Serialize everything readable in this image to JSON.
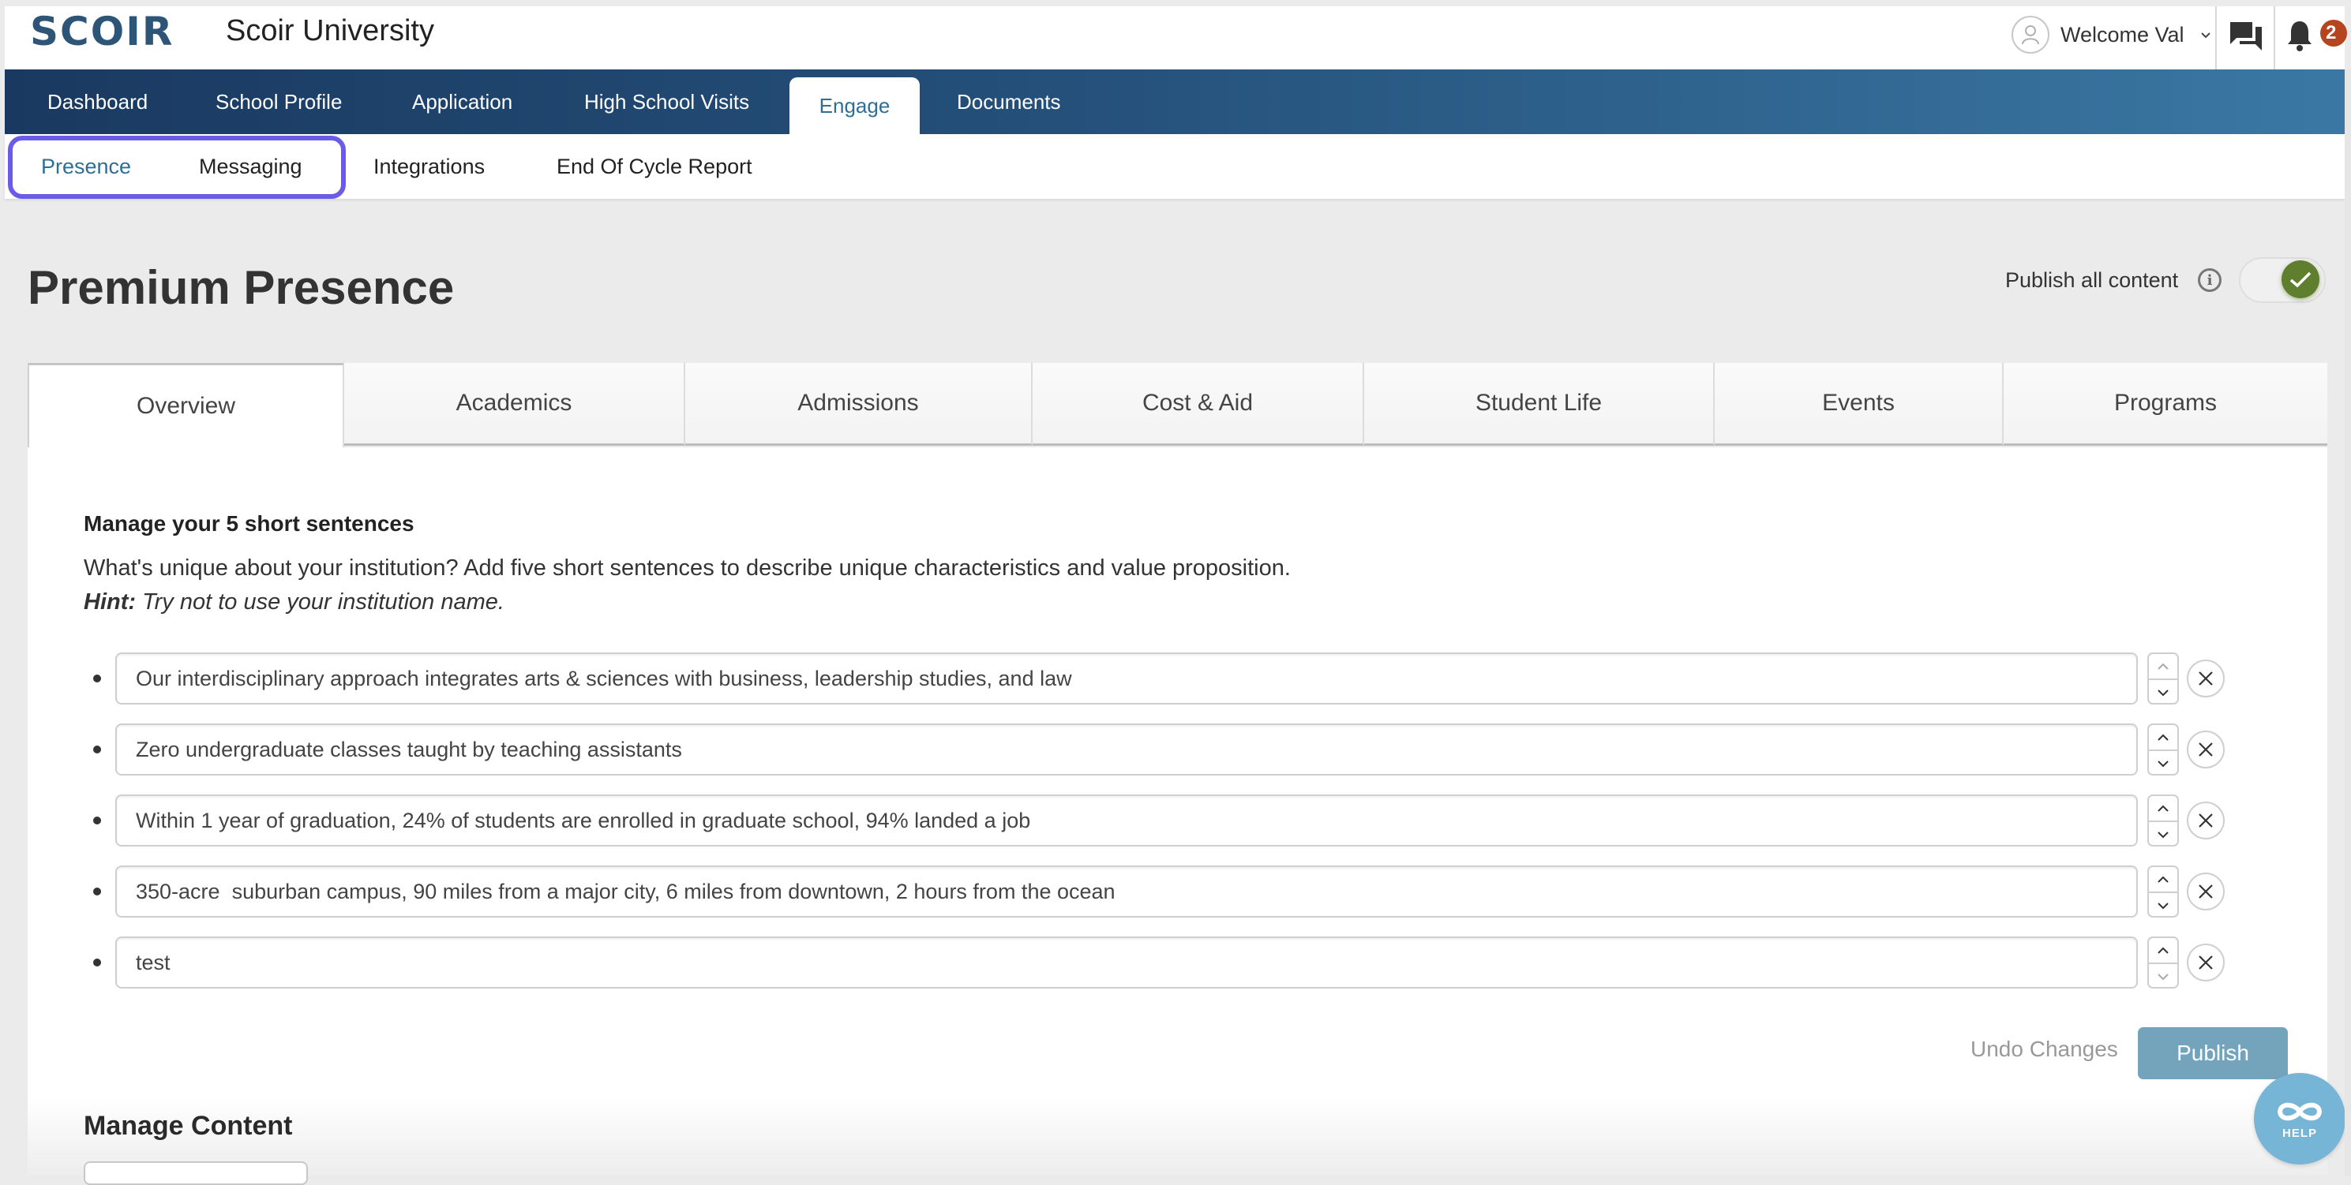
{
  "header": {
    "logo": "SCOIR",
    "school_name": "Scoir University",
    "welcome": "Welcome Val",
    "notification_count": "2"
  },
  "main_nav": {
    "items": [
      {
        "label": "Dashboard",
        "active": false
      },
      {
        "label": "School Profile",
        "active": false
      },
      {
        "label": "Application",
        "active": false
      },
      {
        "label": "High School Visits",
        "active": false
      },
      {
        "label": "Engage",
        "active": true
      },
      {
        "label": "Documents",
        "active": false
      }
    ]
  },
  "sub_nav": {
    "items": [
      {
        "label": "Presence",
        "active": true
      },
      {
        "label": "Messaging",
        "active": false
      },
      {
        "label": "Integrations",
        "active": false
      },
      {
        "label": "End Of Cycle Report",
        "active": false
      }
    ]
  },
  "page": {
    "title": "Premium Presence",
    "publish_all_label": "Publish all content",
    "publish_all_enabled": true
  },
  "tabs": [
    {
      "label": "Overview",
      "active": true
    },
    {
      "label": "Academics",
      "active": false
    },
    {
      "label": "Admissions",
      "active": false
    },
    {
      "label": "Cost & Aid",
      "active": false
    },
    {
      "label": "Student Life",
      "active": false
    },
    {
      "label": "Events",
      "active": false
    },
    {
      "label": "Programs",
      "active": false
    }
  ],
  "sentences_section": {
    "heading": "Manage your 5 short sentences",
    "description": "What's unique about your institution? Add five short sentences to describe unique characteristics and value proposition.",
    "hint_label": "Hint:",
    "hint_text": " Try not to use your institution name.",
    "sentences": [
      "Our interdisciplinary approach integrates arts & sciences with business, leadership studies, and law",
      "Zero undergraduate classes taught by teaching assistants",
      "Within 1 year of graduation, 24% of students are enrolled in graduate school, 94% landed a job",
      "350-acre  suburban campus, 90 miles from a major city, 6 miles from downtown, 2 hours from the ocean",
      "test"
    ],
    "undo_label": "Undo Changes",
    "publish_label": "Publish"
  },
  "manage_content": {
    "heading": "Manage Content"
  },
  "help": {
    "label": "HELP"
  },
  "colors": {
    "nav_start": "#1a3960",
    "nav_end": "#3a78a3",
    "accent": "#2e6f93",
    "highlight": "#6b5ce8",
    "toggle_on": "#5f7e2e",
    "publish_btn": "#74a4bb",
    "badge": "#b5441f",
    "help": "#76b5d6"
  }
}
